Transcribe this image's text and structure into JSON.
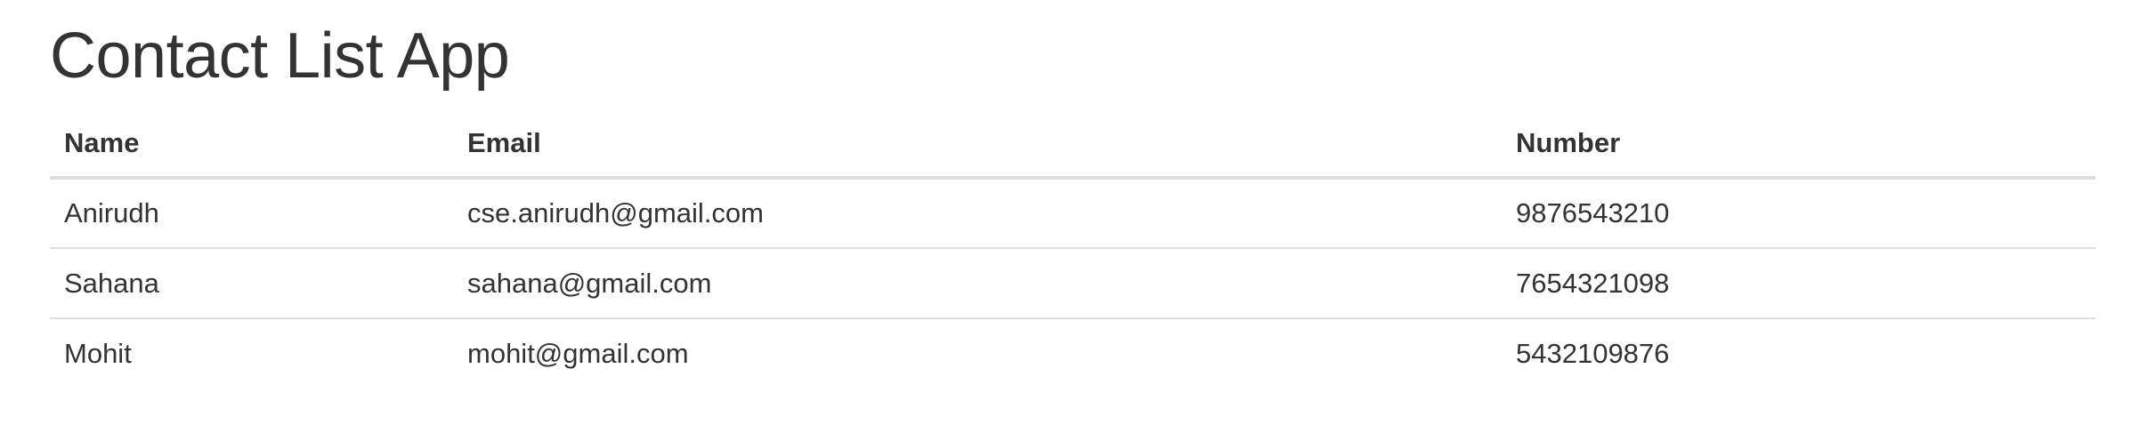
{
  "page": {
    "title": "Contact List App"
  },
  "table": {
    "headers": {
      "name": "Name",
      "email": "Email",
      "number": "Number"
    },
    "rows": [
      {
        "name": "Anirudh",
        "email": "cse.anirudh@gmail.com",
        "number": "9876543210"
      },
      {
        "name": "Sahana",
        "email": "sahana@gmail.com",
        "number": "7654321098"
      },
      {
        "name": "Mohit",
        "email": "mohit@gmail.com",
        "number": "5432109876"
      }
    ]
  },
  "colors": {
    "text": "#333333",
    "border": "#dddddd",
    "background": "#ffffff"
  }
}
